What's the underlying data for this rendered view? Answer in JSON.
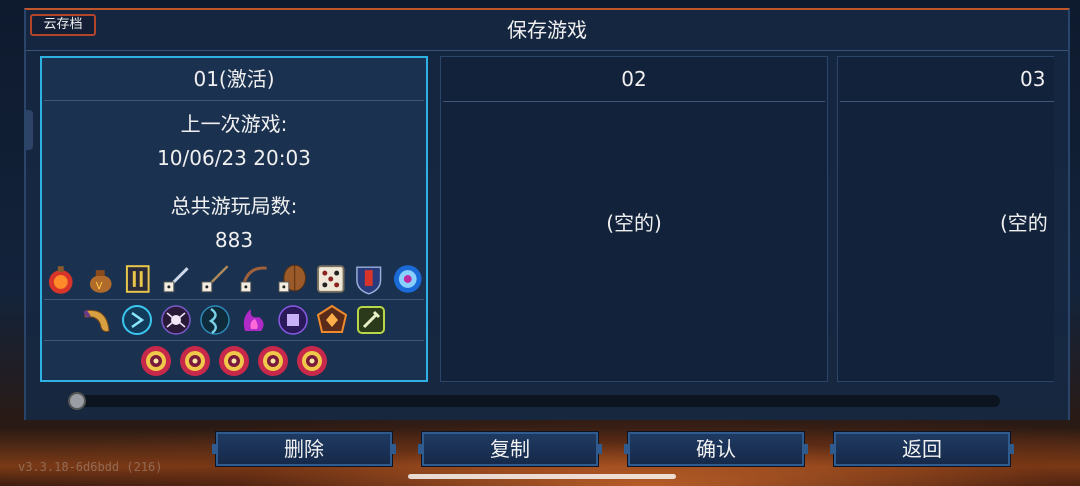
{
  "title": "保存游戏",
  "cloud_button": "云存档",
  "slots": [
    {
      "label": "01(激活)",
      "active": true,
      "last_played_label": "上一次游戏:",
      "last_played_value": "10/06/23 20:03",
      "total_runs_label": "总共游玩局数:",
      "total_runs_value": "883",
      "icons_row1": [
        "fire-flask-icon",
        "gold-bag-icon",
        "scroll-card-icon",
        "dagger-dice-icon",
        "spear-dice-icon",
        "bow-dice-icon",
        "shield-dice-icon",
        "white-dice-icon",
        "crest-shield-icon",
        "eye-orb-icon"
      ],
      "icons_row2": [
        "horn-icon",
        "blue-rune-icon",
        "spider-rune-icon",
        "vine-rune-icon",
        "purple-flame-icon",
        "cube-rune-icon",
        "orange-gem-rune-icon",
        "wrench-rune-icon"
      ],
      "icons_row3": [
        "eye-medallion-icon",
        "eye-medallion-icon",
        "eye-medallion-icon",
        "eye-medallion-icon",
        "eye-medallion-icon"
      ]
    },
    {
      "label": "02",
      "active": false,
      "empty_text": "(空的)"
    },
    {
      "label": "03",
      "active": false,
      "empty_text": "(空的"
    }
  ],
  "buttons": {
    "delete": "删除",
    "copy": "复制",
    "confirm": "确认",
    "back": "返回"
  },
  "version": "v3.3.18-6d6bdd (216)",
  "colors": {
    "active_border": "#2fb1e3",
    "accent": "#c0562a",
    "panel": "#162842"
  }
}
